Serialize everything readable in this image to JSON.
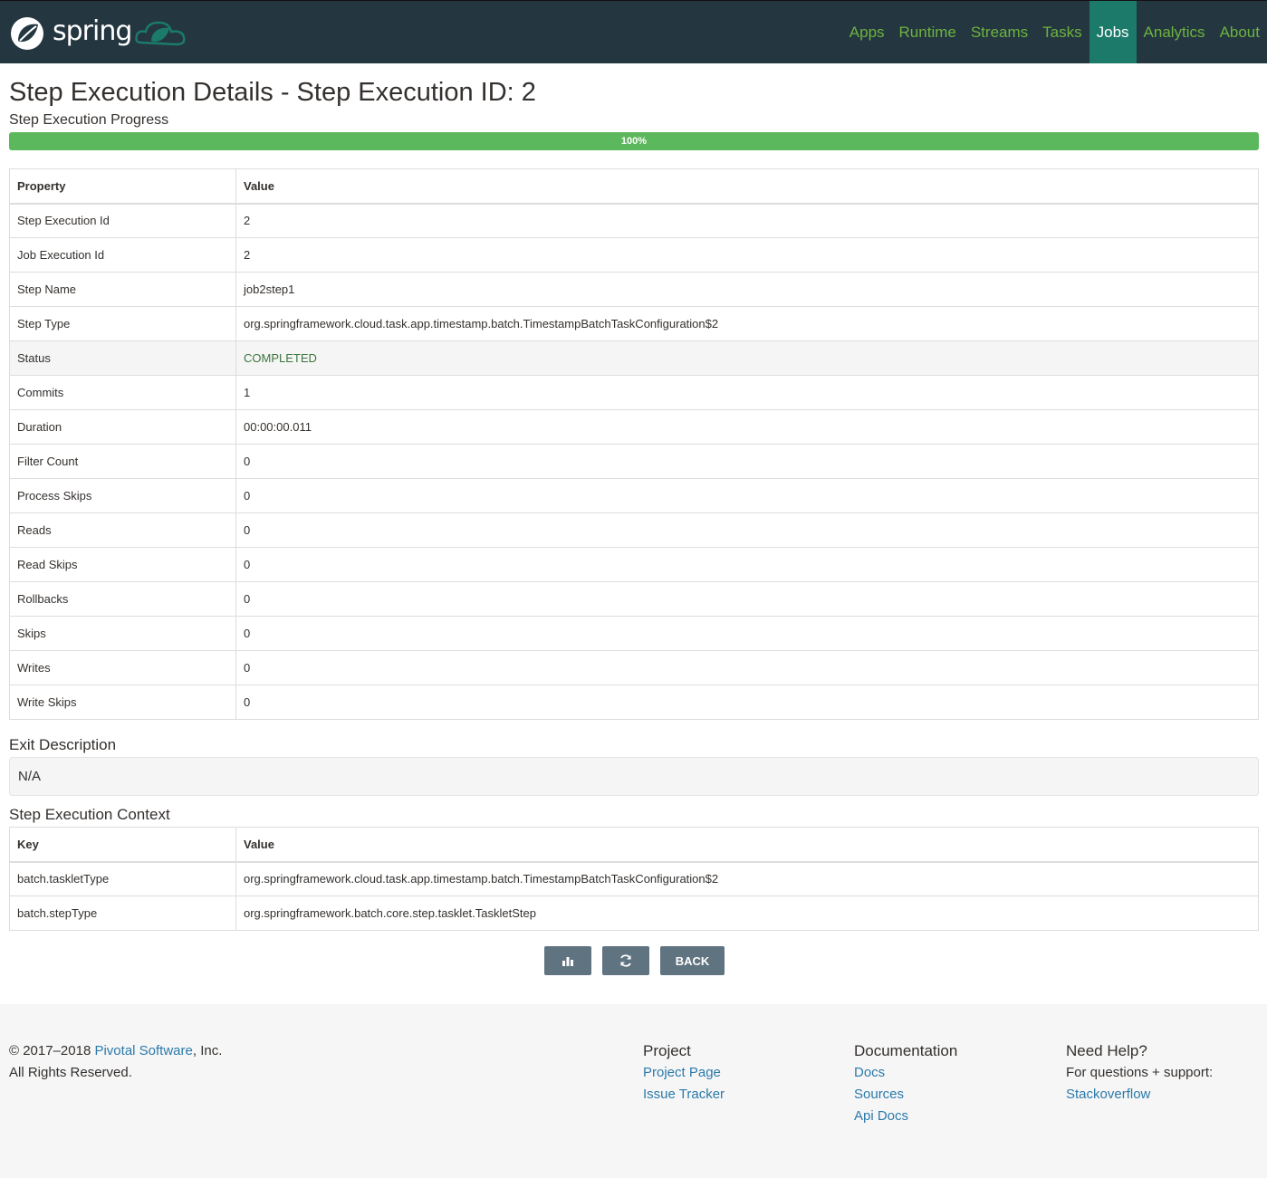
{
  "header": {
    "brand": "spring",
    "nav": [
      {
        "label": "Apps",
        "active": false
      },
      {
        "label": "Runtime",
        "active": false
      },
      {
        "label": "Streams",
        "active": false
      },
      {
        "label": "Tasks",
        "active": false
      },
      {
        "label": "Jobs",
        "active": true
      },
      {
        "label": "Analytics",
        "active": false
      },
      {
        "label": "About",
        "active": false
      }
    ]
  },
  "page": {
    "title": "Step Execution Details - Step Execution ID: 2",
    "progress_label": "Step Execution Progress",
    "progress_value": 1.0,
    "progress_text": "100%"
  },
  "details": {
    "headers": [
      "Property",
      "Value"
    ],
    "rows": [
      {
        "property": "Step Execution Id",
        "value": "2"
      },
      {
        "property": "Job Execution Id",
        "value": "2"
      },
      {
        "property": "Step Name",
        "value": "job2step1"
      },
      {
        "property": "Step Type",
        "value": "org.springframework.cloud.task.app.timestamp.batch.TimestampBatchTaskConfiguration$2"
      },
      {
        "property": "Status",
        "value": "COMPLETED"
      },
      {
        "property": "Commits",
        "value": "1"
      },
      {
        "property": "Duration",
        "value": "00:00:00.011"
      },
      {
        "property": "Filter Count",
        "value": "0"
      },
      {
        "property": "Process Skips",
        "value": "0"
      },
      {
        "property": "Reads",
        "value": "0"
      },
      {
        "property": "Read Skips",
        "value": "0"
      },
      {
        "property": "Rollbacks",
        "value": "0"
      },
      {
        "property": "Skips",
        "value": "0"
      },
      {
        "property": "Writes",
        "value": "0"
      },
      {
        "property": "Write Skips",
        "value": "0"
      }
    ]
  },
  "exit": {
    "title": "Exit Description",
    "value": "N/A"
  },
  "context": {
    "title": "Step Execution Context",
    "headers": [
      "Key",
      "Value"
    ],
    "rows": [
      {
        "key": "batch.taskletType",
        "value": "org.springframework.cloud.task.app.timestamp.batch.TimestampBatchTaskConfiguration$2"
      },
      {
        "key": "batch.stepType",
        "value": "org.springframework.batch.core.step.tasklet.TaskletStep"
      }
    ]
  },
  "buttons": {
    "back_label": "BACK",
    "icon_color": "#5f7380"
  },
  "footer": {
    "copyright_prefix": "© 2017–2018 ",
    "company": "Pivotal Software",
    "copyright_suffix": ", Inc.",
    "rights": "All Rights Reserved.",
    "project": {
      "title": "Project",
      "links": [
        "Project Page",
        "Issue Tracker"
      ]
    },
    "documentation": {
      "title": "Documentation",
      "links": [
        "Docs",
        "Sources",
        "Api Docs"
      ]
    },
    "help": {
      "title": "Need Help?",
      "text": "For questions + support:",
      "link": "Stackoverflow"
    }
  }
}
